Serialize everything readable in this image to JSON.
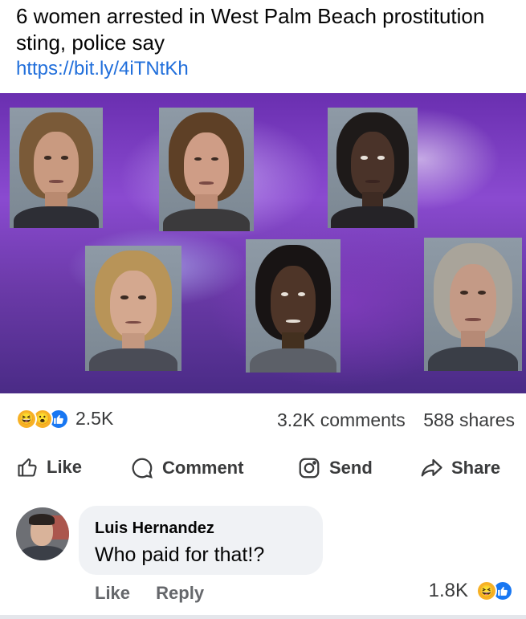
{
  "post": {
    "headline": "6 women arrested in West Palm Beach prostitution sting, police say",
    "link": "https://bit.ly/4iTNtKh"
  },
  "stats": {
    "reaction_count": "2.5K",
    "comments": "3.2K comments",
    "shares": "588 shares",
    "reaction_icons": [
      "haha",
      "wow",
      "like"
    ]
  },
  "actions": {
    "like": "Like",
    "comment": "Comment",
    "send": "Send",
    "share": "Share"
  },
  "comment": {
    "author": "Luis Hernandez",
    "text": "Who paid for that!?",
    "like": "Like",
    "reply": "Reply",
    "reaction_count": "1.8K",
    "reaction_icons": [
      "haha",
      "like"
    ]
  },
  "colors": {
    "link": "#216fdb",
    "like_blue": "#1877f2",
    "emoji_yellow": "#f7b125",
    "bubble": "#f0f2f5"
  }
}
